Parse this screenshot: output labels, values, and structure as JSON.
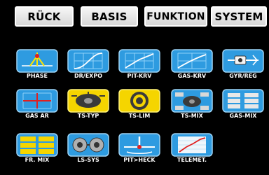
{
  "tabs": [
    "RÜCK",
    "BASIS",
    "FUNKTION",
    "SYSTEM"
  ],
  "menu": {
    "items": [
      {
        "label": "PHASE",
        "icon": "phase-icon"
      },
      {
        "label": "DR/EXPO",
        "icon": "dr-expo-icon"
      },
      {
        "label": "PIT-KRV",
        "icon": "pitch-curve-icon"
      },
      {
        "label": "GAS-KRV",
        "icon": "throttle-curve-icon"
      },
      {
        "label": "GYR/REG",
        "icon": "gyro-governor-icon"
      },
      {
        "label": "GAS AR",
        "icon": "throttle-ar-icon"
      },
      {
        "label": "TS-TYP",
        "icon": "swashplate-type-icon"
      },
      {
        "label": "TS-LIM",
        "icon": "swashplate-limit-icon"
      },
      {
        "label": "TS-MIX",
        "icon": "swashplate-mix-icon"
      },
      {
        "label": "GAS-MIX",
        "icon": "throttle-mix-icon"
      },
      {
        "label": "FR. MIX",
        "icon": "free-mix-icon"
      },
      {
        "label": "LS-SYS",
        "icon": "logical-switch-icon"
      },
      {
        "label": "PIT>HECK",
        "icon": "pitch-tail-icon"
      },
      {
        "label": "TELEMET.",
        "icon": "telemetry-icon"
      }
    ]
  },
  "colors": {
    "background": "#000000",
    "tile_blue": "#2e9be0",
    "tile_yellow": "#f5d500",
    "label": "#ffffff"
  }
}
